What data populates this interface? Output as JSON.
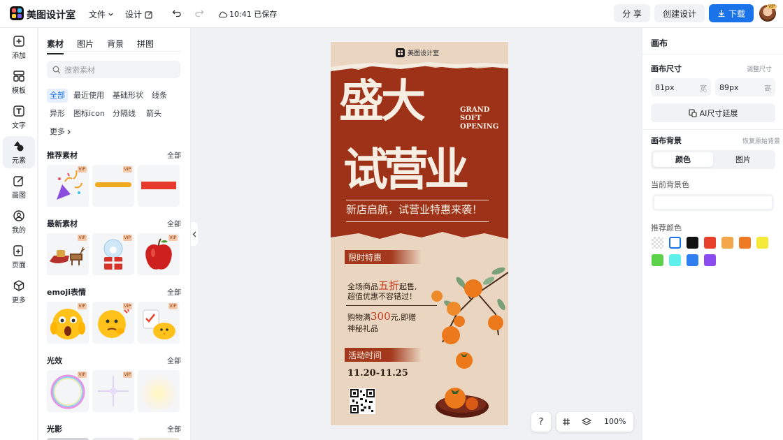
{
  "app": {
    "name": "美图设计室",
    "menu_file": "文件",
    "menu_design": "设计",
    "saved": "10:41 已保存"
  },
  "toolbar": {
    "share": "分 享",
    "create": "创建设计",
    "download": "下载",
    "avatar_badge": "VIP"
  },
  "leftnav": [
    {
      "icon": "plus-square-icon",
      "label": "添加"
    },
    {
      "icon": "template-icon",
      "label": "模板"
    },
    {
      "icon": "text-icon",
      "label": "文字"
    },
    {
      "icon": "element-icon",
      "label": "元素",
      "active": true
    },
    {
      "icon": "draw-icon",
      "label": "画图"
    },
    {
      "icon": "user-icon",
      "label": "我的"
    },
    {
      "icon": "page-icon",
      "label": "页面"
    },
    {
      "icon": "more-cube-icon",
      "label": "更多"
    }
  ],
  "panel": {
    "tabs": [
      "素材",
      "图片",
      "背景",
      "拼图"
    ],
    "search_placeholder": "搜索素材",
    "chips": [
      "全部",
      "最近使用",
      "基础形状",
      "线条",
      "异形",
      "图标icon",
      "分隔线",
      "箭头",
      "更多"
    ],
    "sections": [
      {
        "title": "推荐素材",
        "all": "全部",
        "items": [
          "party-popper",
          "yellow-brush-stroke",
          "red-bar"
        ],
        "vip": [
          true,
          true,
          false
        ]
      },
      {
        "title": "最新素材",
        "all": "全部",
        "items": [
          "reindeer-sleigh",
          "snow-globe-gift",
          "red-apple"
        ],
        "vip": [
          true,
          true,
          true
        ]
      },
      {
        "title": "emoji表情",
        "all": "全部",
        "items": [
          "shocked-emoji",
          "thinking-emoji",
          "checklist-chick"
        ],
        "vip": [
          true,
          true,
          true
        ]
      },
      {
        "title": "光效",
        "all": "全部",
        "items": [
          "bubble-ring",
          "star-sparkle",
          "glow-light"
        ],
        "vip": [
          true,
          true,
          false
        ]
      },
      {
        "title": "光影",
        "all": "全部",
        "items": [],
        "vip": []
      }
    ]
  },
  "poster": {
    "brand": "美图设计室",
    "title_line1": "盛大",
    "title_line2": "试营业",
    "english": [
      "GRAND",
      "SOFT",
      "OPENING"
    ],
    "slogan": "新店启航，试营业特惠来袭！",
    "promo_label": "限时特惠",
    "promo_line1_a": "全场商品",
    "promo_line1_b": "五折",
    "promo_line1_c": "起售,",
    "promo_line2": "超值优惠不容错过！",
    "promo_line3_a": "购物满",
    "promo_line3_b": "300",
    "promo_line3_c": "元,即赠",
    "promo_line4": "神秘礼品",
    "time_label": "活动时间",
    "dates": "11.20-11.25"
  },
  "right": {
    "title": "画布",
    "size_label": "画布尺寸",
    "resize_link": "调整尺寸",
    "width_value": "81px",
    "width_unit": "宽",
    "height_value": "89px",
    "height_unit": "高",
    "ai_button": "AI尺寸延展",
    "bg_label": "画布背景",
    "bg_reset": "恢复原始背景",
    "seg_color": "颜色",
    "seg_image": "图片",
    "current_bg": "当前背景色",
    "recommend": "推荐颜色",
    "swatches": [
      "transparent",
      "#ffffff",
      "#111111",
      "#e8402b",
      "#f3a64a",
      "#ef7a26",
      "#f5ea3a",
      "#5bd24a",
      "#5ef0ea",
      "#2f7ff0",
      "#8a4cf0"
    ]
  },
  "zoom": {
    "help": "?",
    "level": "100%"
  }
}
